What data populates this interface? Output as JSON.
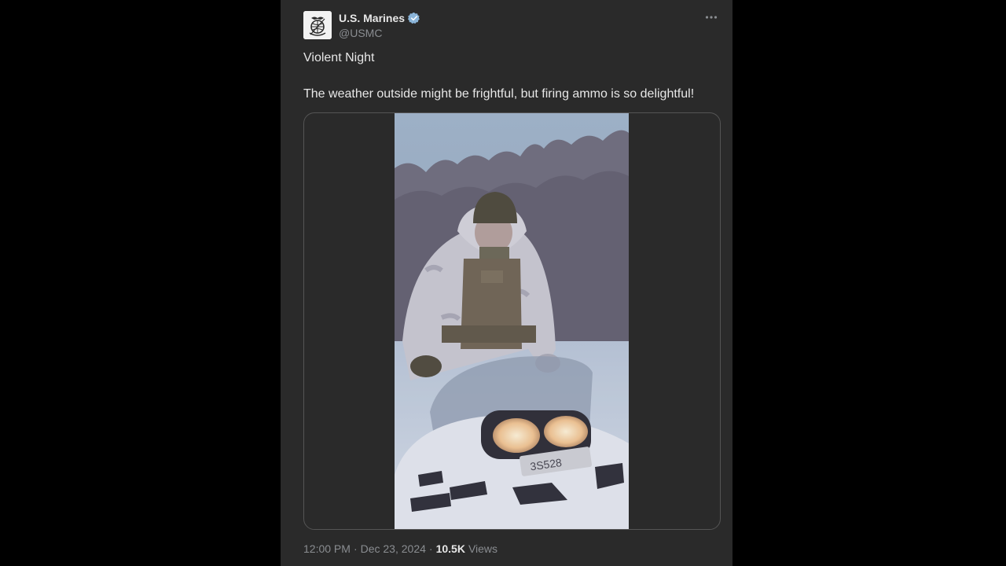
{
  "tweet": {
    "author_name": "U.S. Marines",
    "author_handle": "@USMC",
    "verified_icon": "verified-badge-icon",
    "more_icon": "more-options-icon",
    "text_line_1": "Violent Night",
    "text_line_2": "The weather outside might be frightful, but firing ammo is so delightful!",
    "time": "12:00 PM",
    "date": "Dec 23, 2024",
    "separator": "·",
    "views_count": "10.5K",
    "views_label": "Views"
  },
  "media": {
    "type": "video",
    "icon": "video-thumbnail",
    "plate_text": "3S528"
  },
  "colors": {
    "background": "#000000",
    "card": "#2a2a2a",
    "text_primary": "#e7e7e7",
    "text_secondary": "#8a8d91",
    "verified": "#8ab4d8"
  }
}
